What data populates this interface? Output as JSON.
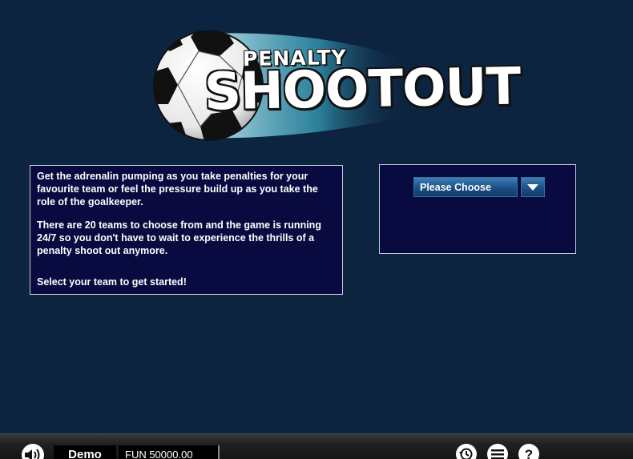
{
  "logo": {
    "line1": "PENALTY",
    "line2": "SHOOTOUT"
  },
  "info": {
    "paragraph1": "Get the adrenalin pumping as you take penalties for your favourite team or feel the pressure build up as you take the role of the goalkeeper.",
    "paragraph2": "There are 20 teams to choose from and the game is running 24/7 so you don't have to wait to experience the thrills of a penalty shoot out anymore.",
    "paragraph3": "Select your team to get started!"
  },
  "team_select": {
    "selected": "Please Choose"
  },
  "bottom_bar": {
    "mode_label": "Demo",
    "balance": "FUN 50000.00",
    "help_glyph": "?"
  },
  "icons": {
    "sound": "speaker-icon",
    "history": "history-icon",
    "menu": "hamburger-menu-icon",
    "help": "question-mark-icon",
    "dropdown": "caret-down-icon"
  },
  "colors": {
    "background": "#0d2440",
    "panel": "#090a3f",
    "panel_border": "#c9c9d8",
    "button": "#1b4f86"
  }
}
